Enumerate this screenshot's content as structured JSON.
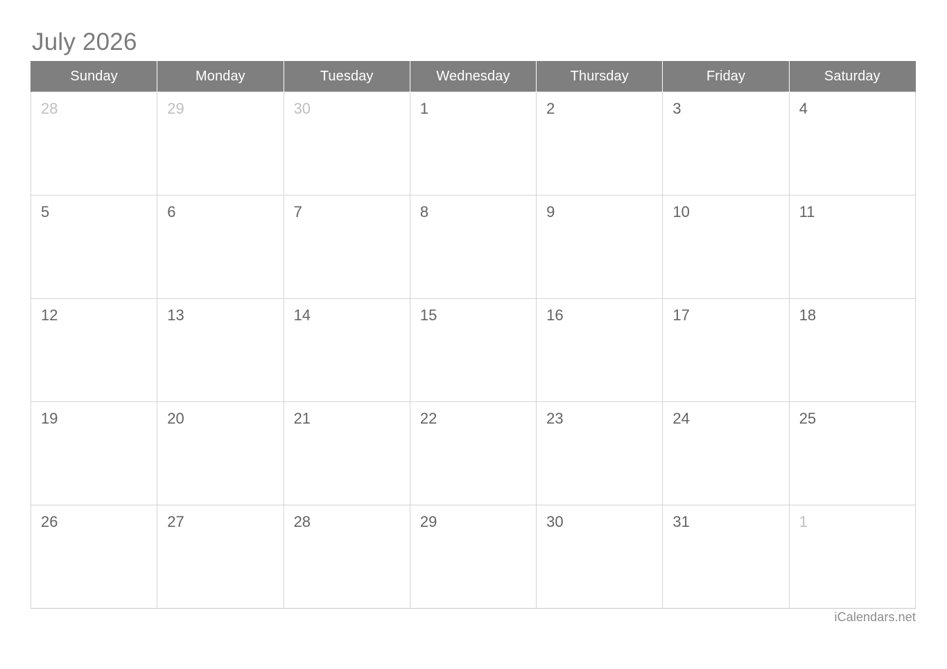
{
  "title": "July 2026",
  "weekdays": [
    "Sunday",
    "Monday",
    "Tuesday",
    "Wednesday",
    "Thursday",
    "Friday",
    "Saturday"
  ],
  "weeks": [
    [
      {
        "day": "28",
        "adjacent": true
      },
      {
        "day": "29",
        "adjacent": true
      },
      {
        "day": "30",
        "adjacent": true
      },
      {
        "day": "1",
        "adjacent": false
      },
      {
        "day": "2",
        "adjacent": false
      },
      {
        "day": "3",
        "adjacent": false
      },
      {
        "day": "4",
        "adjacent": false
      }
    ],
    [
      {
        "day": "5",
        "adjacent": false
      },
      {
        "day": "6",
        "adjacent": false
      },
      {
        "day": "7",
        "adjacent": false
      },
      {
        "day": "8",
        "adjacent": false
      },
      {
        "day": "9",
        "adjacent": false
      },
      {
        "day": "10",
        "adjacent": false
      },
      {
        "day": "11",
        "adjacent": false
      }
    ],
    [
      {
        "day": "12",
        "adjacent": false
      },
      {
        "day": "13",
        "adjacent": false
      },
      {
        "day": "14",
        "adjacent": false
      },
      {
        "day": "15",
        "adjacent": false
      },
      {
        "day": "16",
        "adjacent": false
      },
      {
        "day": "17",
        "adjacent": false
      },
      {
        "day": "18",
        "adjacent": false
      }
    ],
    [
      {
        "day": "19",
        "adjacent": false
      },
      {
        "day": "20",
        "adjacent": false
      },
      {
        "day": "21",
        "adjacent": false
      },
      {
        "day": "22",
        "adjacent": false
      },
      {
        "day": "23",
        "adjacent": false
      },
      {
        "day": "24",
        "adjacent": false
      },
      {
        "day": "25",
        "adjacent": false
      }
    ],
    [
      {
        "day": "26",
        "adjacent": false
      },
      {
        "day": "27",
        "adjacent": false
      },
      {
        "day": "28",
        "adjacent": false
      },
      {
        "day": "29",
        "adjacent": false
      },
      {
        "day": "30",
        "adjacent": false
      },
      {
        "day": "31",
        "adjacent": false
      },
      {
        "day": "1",
        "adjacent": true
      }
    ]
  ],
  "footer": "iCalendars.net",
  "colors": {
    "header_background": "#7f7f7f",
    "header_text": "#ffffff",
    "title_text": "#7b7b7b",
    "day_text": "#636363",
    "adjacent_day_text": "#bfbfbf",
    "adjacent_cell_background": "#f0f0f0",
    "grid_border": "#d4d4d4",
    "footer_text": "#8c8c8c"
  }
}
